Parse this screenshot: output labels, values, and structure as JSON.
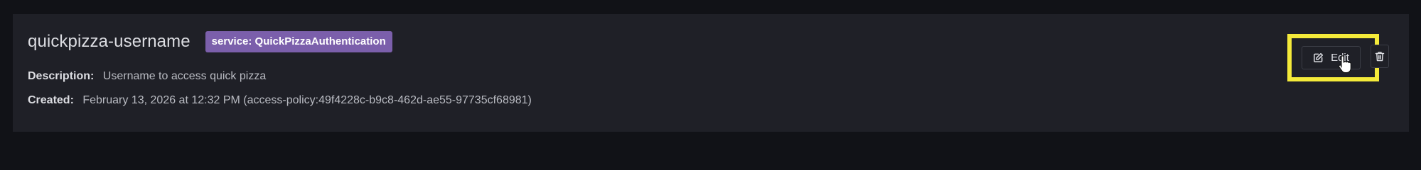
{
  "secret": {
    "name": "quickpizza-username",
    "badge": "service: QuickPizzaAuthentication",
    "description_label": "Description:",
    "description": "Username to access quick pizza",
    "created_label": "Created:",
    "created": "February 13, 2026 at 12:32 PM (access-policy:49f4228c-b9c8-462d-ae55-97735cf68981)"
  },
  "actions": {
    "edit_label": "Edit",
    "edit_icon": "pencil-square-icon",
    "delete_icon": "trash-icon"
  },
  "colors": {
    "badge_bg": "#7b5fab",
    "highlight": "#f4ea3a",
    "card_bg": "#1f2027",
    "page_bg": "#111217"
  }
}
